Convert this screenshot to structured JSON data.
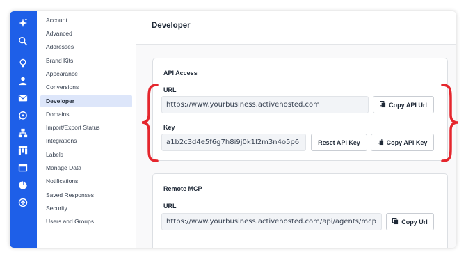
{
  "rail": {
    "icons": [
      "sparkle-icon",
      "search-icon",
      "lightbulb-icon",
      "contacts-icon",
      "email-icon",
      "whatsapp-icon",
      "automations-icon",
      "pipelines-icon",
      "website-icon",
      "reports-icon",
      "apps-icon"
    ],
    "color": "#1e5fe8"
  },
  "menu": {
    "items": [
      {
        "label": "Account"
      },
      {
        "label": "Advanced"
      },
      {
        "label": "Addresses"
      },
      {
        "label": "Brand Kits"
      },
      {
        "label": "Appearance"
      },
      {
        "label": "Conversions"
      },
      {
        "label": "Developer",
        "active": true
      },
      {
        "label": "Domains"
      },
      {
        "label": "Import/Export Status"
      },
      {
        "label": "Integrations"
      },
      {
        "label": "Labels"
      },
      {
        "label": "Manage Data"
      },
      {
        "label": "Notifications"
      },
      {
        "label": "Saved Responses"
      },
      {
        "label": "Security"
      },
      {
        "label": "Users and Groups"
      }
    ]
  },
  "page": {
    "title": "Developer"
  },
  "api_access": {
    "title": "API Access",
    "url_label": "URL",
    "url_value": "https://www.yourbusiness.activehosted.com",
    "copy_url_button": "Copy API Url",
    "key_label": "Key",
    "key_value": "a1b2c3d4e5f6g7h8i9j0k1l2m3n4o5p6",
    "reset_key_button": "Reset API Key",
    "copy_key_button": "Copy API Key"
  },
  "remote_mcp": {
    "title": "Remote MCP",
    "url_label": "URL",
    "url_value": "https://www.yourbusiness.activehosted.com/api/agents/mcp",
    "copy_url_button": "Copy Url"
  },
  "highlight": {
    "color": "#e5262d"
  }
}
